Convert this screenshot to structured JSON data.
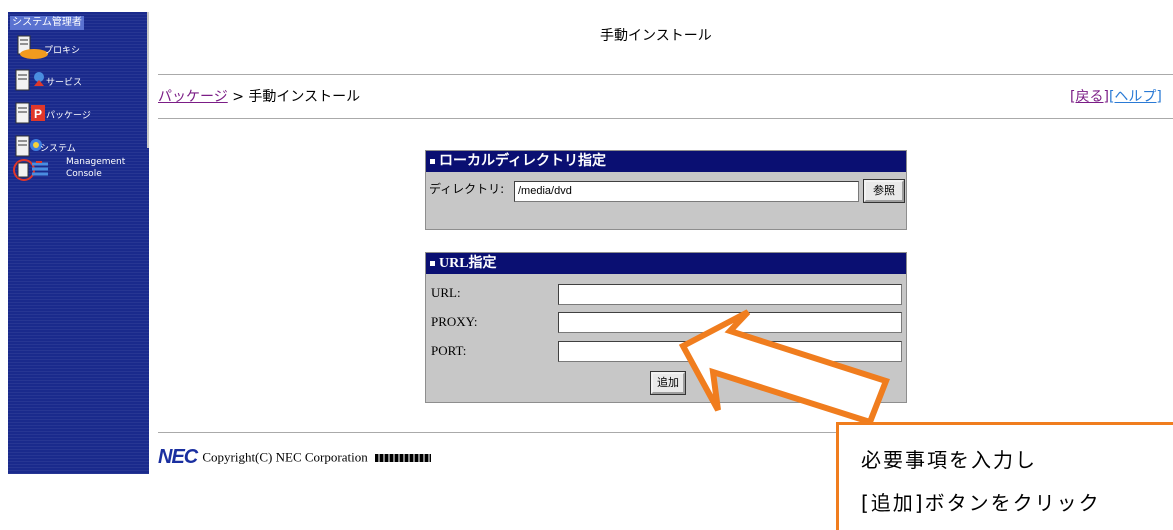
{
  "sidebar": {
    "title": "システム管理者",
    "items": [
      {
        "label": "プロキシ",
        "icon": "proxy-server-icon"
      },
      {
        "label": "サービス",
        "icon": "service-icon"
      },
      {
        "label": "パッケージ",
        "icon": "package-icon"
      },
      {
        "label": "システム",
        "icon": "system-icon"
      },
      {
        "label": "Management",
        "label2": "Console",
        "icon": "management-console-icon"
      }
    ]
  },
  "header": {
    "title": "手動インストール",
    "breadcrumb": {
      "link": "パッケージ",
      "separator": ">",
      "current": "手動インストール"
    },
    "back_link": "[戻る]",
    "help_link": "[ヘルプ]"
  },
  "local_panel": {
    "title": "ローカルディレクトリ指定",
    "dir_label": "ディレクトリ:",
    "dir_value": "/media/dvd",
    "browse_button": "参照"
  },
  "url_panel": {
    "title": "URL指定",
    "url_label": "URL:",
    "url_value": "",
    "proxy_label": "PROXY:",
    "proxy_value": "",
    "port_label": "PORT:",
    "port_value": "",
    "add_button": "追加"
  },
  "footer": {
    "logo": "NEC",
    "copyright": "Copyright(C) NEC Corporation"
  },
  "annotation": {
    "line1": "必要事項を入力し",
    "line2": "[追加]ボタンをクリック"
  },
  "colors": {
    "sidebar_bg": "#1a2a8c",
    "panel_header_bg": "#0a0f72",
    "panel_bg": "#c7c7c7",
    "link_visited": "#7b1d86",
    "callout_orange": "#f07d1e"
  }
}
